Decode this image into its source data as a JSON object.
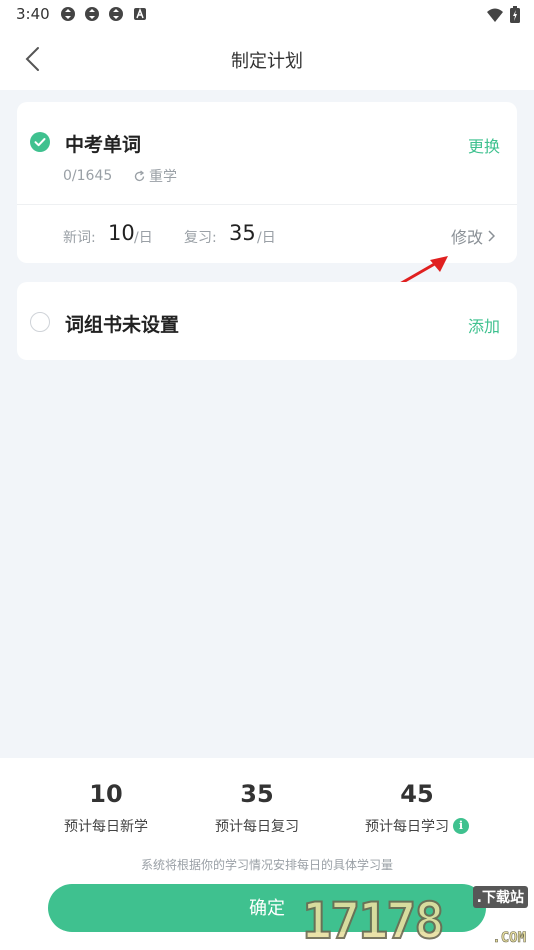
{
  "status_bar": {
    "time": "3:40",
    "icons": [
      "sync-icon",
      "sync-icon",
      "sync-icon",
      "text-a-icon"
    ],
    "right_icons": [
      "wifi-icon",
      "battery-icon"
    ]
  },
  "header": {
    "title": "制定计划",
    "back_icon": "chevron-left-icon"
  },
  "plan_cards": [
    {
      "title": "中考单词",
      "selected": true,
      "action": "更换",
      "progress": "0/1645",
      "restudy_label": "重学",
      "new_words_label": "新词:",
      "new_words_value": "10",
      "new_words_unit": "/日",
      "review_label": "复习:",
      "review_value": "35",
      "review_unit": "/日",
      "modify_label": "修改"
    },
    {
      "title": "词组书未设置",
      "selected": false,
      "action": "添加"
    }
  ],
  "summary": {
    "items": [
      {
        "value": "10",
        "label": "预计每日新学"
      },
      {
        "value": "35",
        "label": "预计每日复习"
      },
      {
        "value": "45",
        "label": "预计每日学习",
        "info_icon": "i"
      }
    ],
    "note": "系统将根据你的学习情况安排每日的具体学习量",
    "confirm_label": "确定"
  },
  "watermark": {
    "number": "17178",
    "tag": ".下载站",
    "domain": ".COM"
  },
  "colors": {
    "accent": "#3fc18f",
    "background": "#f2f5f9",
    "annotation_arrow": "#e02020"
  }
}
